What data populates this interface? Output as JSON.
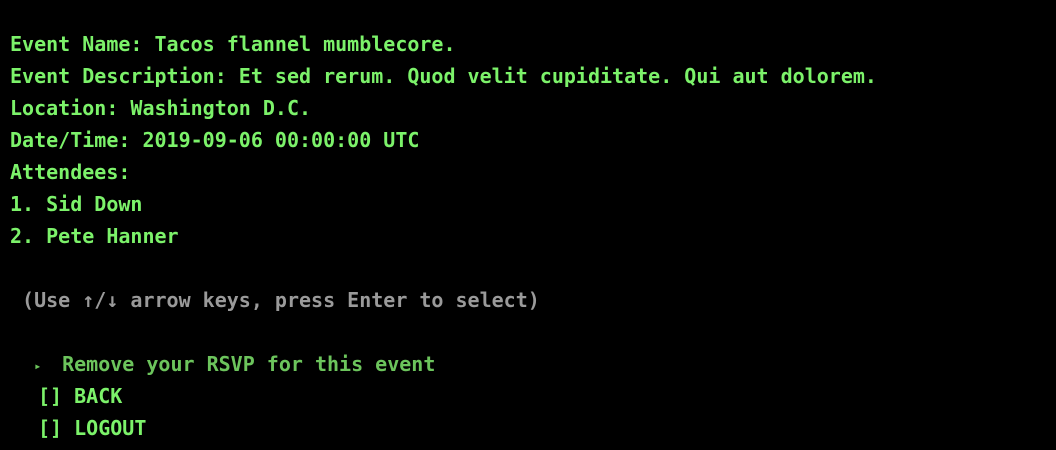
{
  "event": {
    "name_line": "Event Name: Tacos flannel mumblecore.",
    "description_line": "Event Description: Et sed rerum. Quod velit cupiditate. Qui aut dolorem.",
    "location_line": "Location: Washington D.C.",
    "datetime_line": "Date/Time: 2019-09-06 00:00:00 UTC",
    "attendees_heading": "Attendees:",
    "attendees": [
      "1. Sid Down",
      "2. Pete Hanner"
    ]
  },
  "prompt": {
    "hint": " (Use ↑/↓ arrow keys, press Enter to select)",
    "pointer_icon": "triangle-right-icon",
    "selected_item": "Remove your RSVP for this event",
    "options": [
      "[] BACK",
      "[] LOGOUT"
    ]
  },
  "colors": {
    "background": "#000000",
    "text": "#7cf26a",
    "hint": "#9a9a9a",
    "selected": "#6cc45c"
  }
}
